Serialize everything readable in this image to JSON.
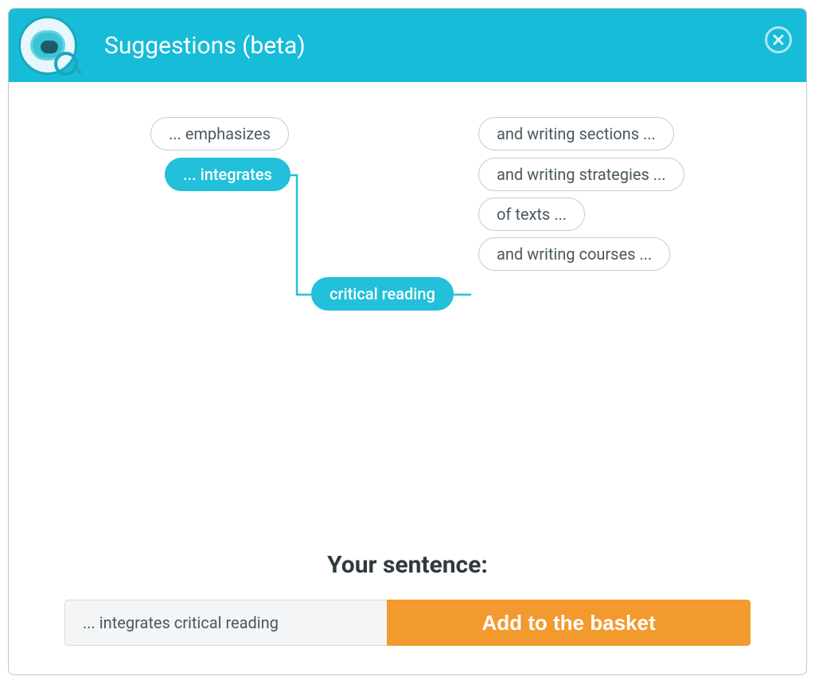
{
  "header": {
    "title": "Suggestions (beta)"
  },
  "left_options": [
    {
      "label": "... emphasizes",
      "selected": false
    },
    {
      "label": "... integrates",
      "selected": true
    }
  ],
  "middle_node": {
    "label": "critical reading"
  },
  "right_options": [
    {
      "label": "and writing sections ..."
    },
    {
      "label": "and writing strategies ..."
    },
    {
      "label": "of texts ..."
    },
    {
      "label": "and writing courses ..."
    }
  ],
  "bottom": {
    "heading": "Your sentence:",
    "sentence": "... integrates critical reading",
    "button_label": "Add to the basket"
  },
  "colors": {
    "accent": "#22c0da",
    "action": "#f39a2e"
  }
}
